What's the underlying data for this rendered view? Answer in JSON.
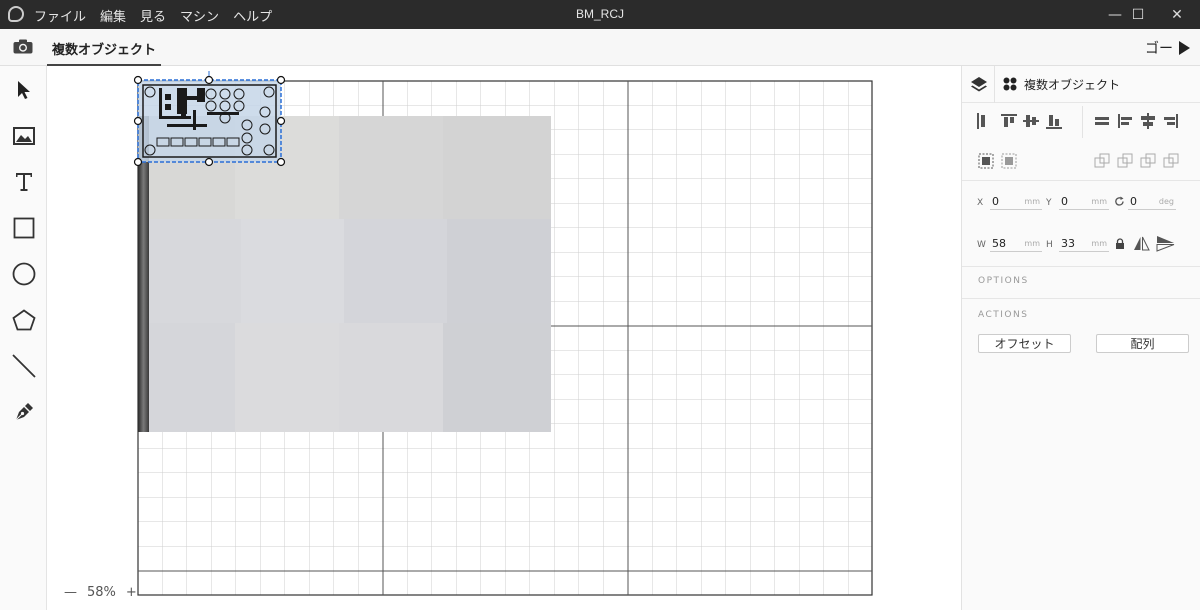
{
  "window": {
    "title": "BM_RCJ",
    "menu": [
      "ファイル",
      "編集",
      "見る",
      "マシン",
      "ヘルプ"
    ],
    "controls": {
      "minimize": "—",
      "maximize": "☐",
      "close": "✕"
    }
  },
  "toolbar": {
    "camera_icon": "camera-icon",
    "active_tab": "複数オブジェクト",
    "go_label": "ゴー"
  },
  "tools": [
    "select-arrow-icon",
    "image-icon",
    "text-icon",
    "rectangle-icon",
    "circle-icon",
    "polygon-icon",
    "line-icon",
    "pen-icon"
  ],
  "canvas": {
    "zoom": "58%",
    "zoom_out": "—",
    "zoom_in": "+"
  },
  "panel": {
    "header_title": "複数オブジェクト",
    "position": {
      "x_label": "X",
      "x_value": "0",
      "x_unit": "mm",
      "y_label": "Y",
      "y_value": "0",
      "y_unit": "mm",
      "rot_value": "0",
      "rot_unit": "deg"
    },
    "size": {
      "w_label": "W",
      "w_value": "58",
      "w_unit": "mm",
      "h_label": "H",
      "h_value": "33",
      "h_unit": "mm"
    },
    "options_title": "OPTIONS",
    "actions_title": "ACTIONS",
    "offset_button": "オフセット",
    "array_button": "配列"
  },
  "colors": {
    "titlebar": "#2b2b2b",
    "selection": "#2a6fd6",
    "grid": "#cfcfcf",
    "grid_major": "#555555"
  }
}
